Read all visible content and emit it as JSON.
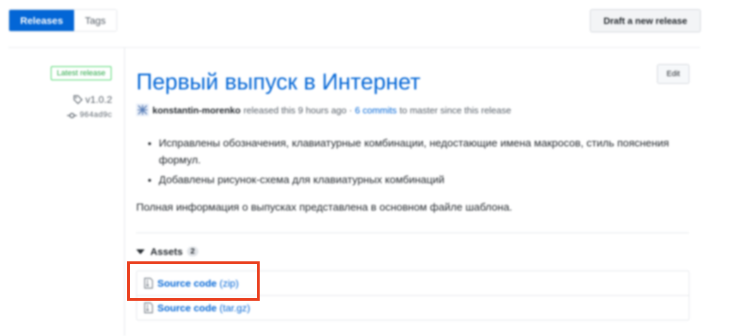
{
  "tabs": {
    "releases": "Releases",
    "tags": "Tags"
  },
  "draft_button": "Draft a new release",
  "sidebar": {
    "latest_badge": "Latest release",
    "tag": "v1.0.2",
    "commit": "964ad9c"
  },
  "release": {
    "title": "Первый выпуск в Интернет",
    "edit_button": "Edit",
    "author": "konstantin-morenko",
    "released_text": "released this 9 hours ago ·",
    "commits_link": "6 commits",
    "commits_suffix": "to master since this release",
    "bullets": [
      "Исправлены обозначения, клавиатурные комбинации, недостающие имена макросов, стиль пояснения формул.",
      "Добавлены рисунок-схема для клавиатурных комбинаций"
    ],
    "paragraph": "Полная информация о выпусках представлена в основном файле шаблона."
  },
  "assets": {
    "heading": "Assets",
    "count": "2",
    "items": [
      {
        "name": "Source code",
        "ext": "(zip)"
      },
      {
        "name": "Source code",
        "ext": "(tar.gz)"
      }
    ]
  },
  "colors": {
    "accent": "#0366d6",
    "latest": "#28a745",
    "highlight": "#ea3f1e"
  }
}
